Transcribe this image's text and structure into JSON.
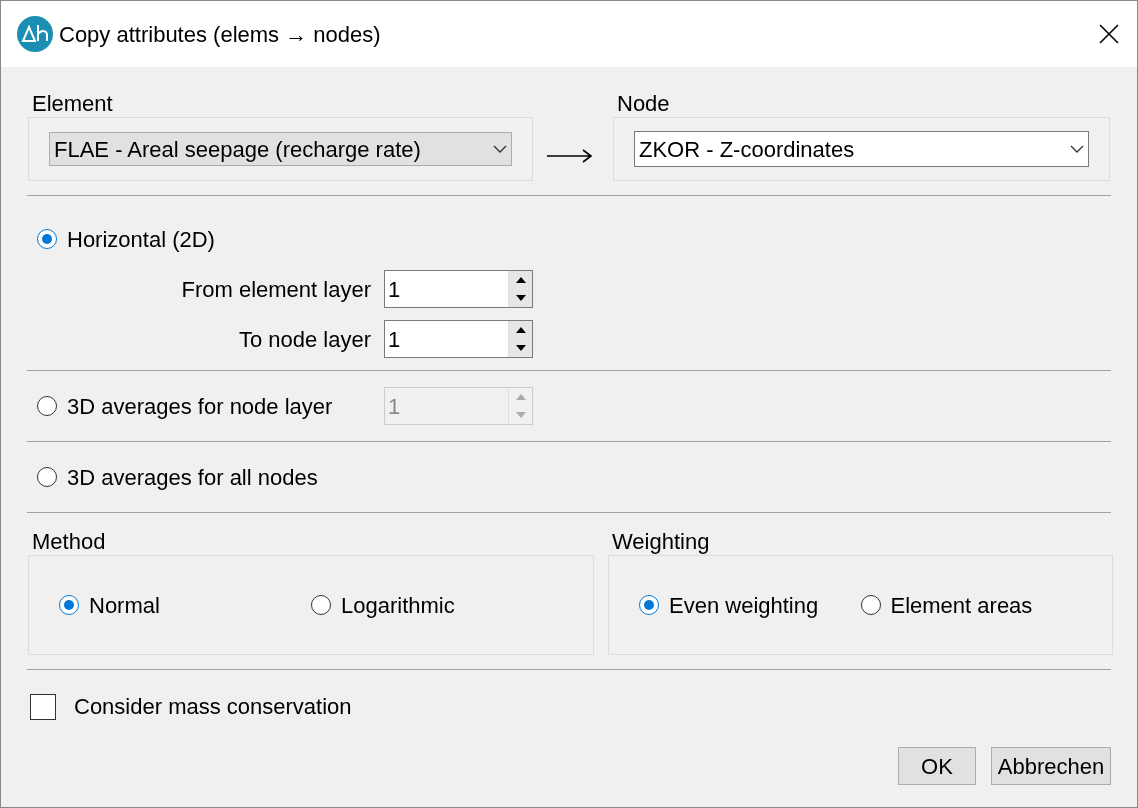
{
  "window": {
    "title": "Copy attributes (elems → nodes)"
  },
  "element": {
    "label": "Element",
    "value": "FLAE - Areal seepage (recharge rate)"
  },
  "node": {
    "label": "Node",
    "value": "ZKOR - Z-coordinates"
  },
  "modes": [
    {
      "kind": "nested",
      "label": "Horizontal (2D)",
      "selected": true,
      "fields": [
        {
          "label": "From element layer",
          "value": "1",
          "disabled": false
        },
        {
          "label": "To node layer",
          "value": "1",
          "disabled": false
        }
      ]
    },
    {
      "kind": "inline",
      "label": "3D averages for node layer",
      "selected": false,
      "fields": [
        {
          "value": "1",
          "disabled": true
        }
      ]
    },
    {
      "kind": "inline",
      "label": "3D averages for all nodes",
      "selected": false
    }
  ],
  "method": {
    "label": "Method",
    "options": [
      {
        "label": "Normal",
        "selected": true
      },
      {
        "label": "Logarithmic",
        "selected": false
      }
    ]
  },
  "weighting": {
    "label": "Weighting",
    "options": [
      {
        "label": "Even weighting",
        "selected": true
      },
      {
        "label": "Element areas",
        "selected": false
      }
    ]
  },
  "mass_conservation": {
    "label": "Consider mass conservation",
    "checked": false
  },
  "buttons": [
    {
      "label": "OK"
    },
    {
      "label": "Abbrechen"
    }
  ]
}
